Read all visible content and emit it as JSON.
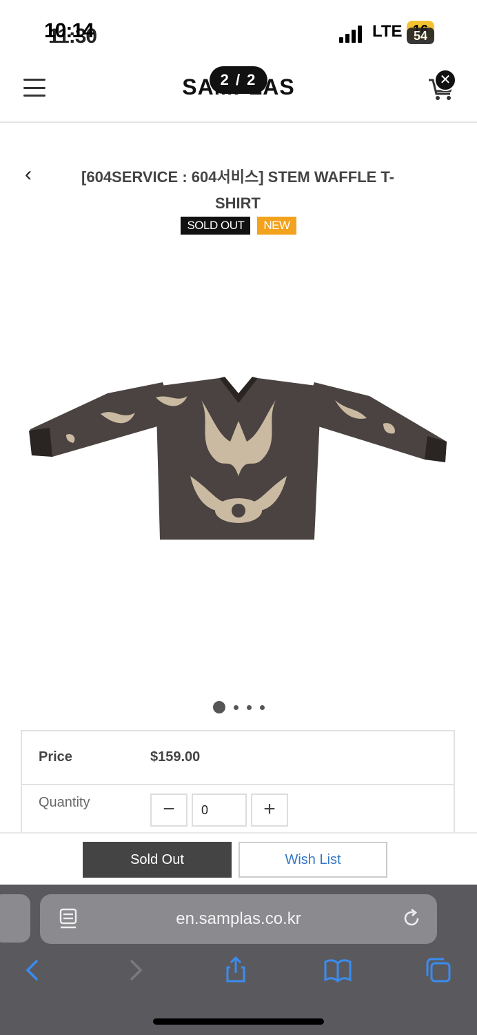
{
  "status": {
    "time_primary": "10:14",
    "time_secondary": "11:30",
    "network": "LTE",
    "battery_primary": "16",
    "battery_secondary": "54"
  },
  "header": {
    "logo": "SAMPLAS",
    "image_counter": "2 / 2"
  },
  "product": {
    "title": "[604SERVICE : 604서비스] STEM WAFFLE T-SHIRT",
    "badges": [
      "SOLD OUT",
      "NEW"
    ],
    "image_colors": {
      "garment": "#4a4341",
      "print": "#d9c7ad"
    }
  },
  "carousel": {
    "total": 4,
    "active": 0
  },
  "info": {
    "price_label": "Price",
    "price_value": "$159.00",
    "quantity_label": "Quantity",
    "quantity_value": "0",
    "minus": "−",
    "plus": "+"
  },
  "actions": {
    "sold_out": "Sold Out",
    "wish_list": "Wish List"
  },
  "browser": {
    "url": "en.samplas.co.kr"
  }
}
